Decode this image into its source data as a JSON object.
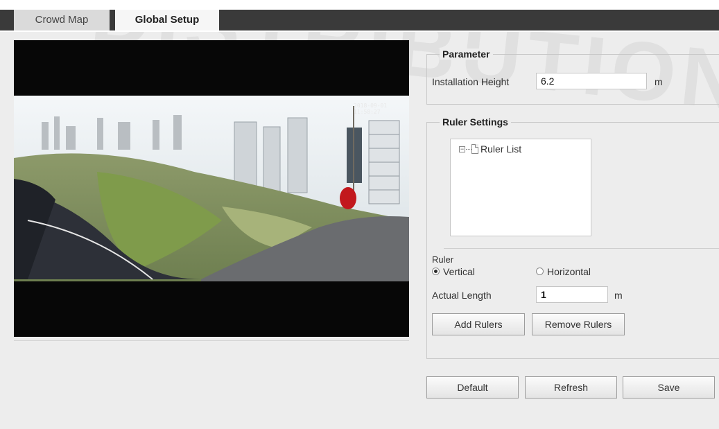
{
  "tabs": [
    {
      "label": "Crowd Map",
      "active": false
    },
    {
      "label": "Global Setup",
      "active": true
    }
  ],
  "video": {
    "osd_text": "2018-09-01 11:58:27"
  },
  "parameter": {
    "legend": "Parameter",
    "installation_height_label": "Installation Height",
    "installation_height_value": "6.2",
    "unit": "m"
  },
  "ruler_settings": {
    "legend": "Ruler Settings",
    "tree_root_label": "Ruler List",
    "ruler_label": "Ruler",
    "orientation_options": [
      "Vertical",
      "Horizontal"
    ],
    "selected_orientation": "Vertical",
    "actual_length_label": "Actual Length",
    "actual_length_value": "1",
    "unit": "m",
    "add_button": "Add Rulers",
    "remove_button": "Remove Rulers"
  },
  "footer_buttons": {
    "default": "Default",
    "refresh": "Refresh",
    "save": "Save"
  },
  "watermark": "DISTRIBUTION"
}
